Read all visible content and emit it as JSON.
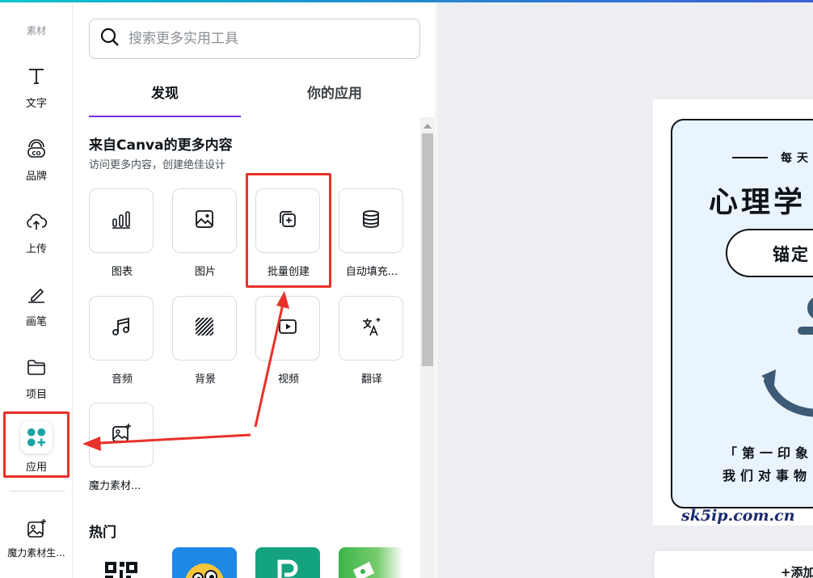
{
  "colors": {
    "accent_purple": "#7d2ae8",
    "annotation_red": "#e8312a",
    "apps_teal": "#1aa3a3"
  },
  "rail": {
    "top_label": "素材",
    "items": [
      {
        "label": "文字",
        "icon": "text-icon"
      },
      {
        "label": "品牌",
        "icon": "brand-icon"
      },
      {
        "label": "上传",
        "icon": "cloud-upload-icon"
      },
      {
        "label": "画笔",
        "icon": "pen-icon"
      },
      {
        "label": "项目",
        "icon": "folder-icon"
      },
      {
        "label": "应用",
        "icon": "apps-icon"
      },
      {
        "label": "魔力素材生...",
        "icon": "magic-media-icon"
      }
    ]
  },
  "panel": {
    "search_placeholder": "搜索更多实用工具",
    "tabs": [
      "发现",
      "你的应用"
    ],
    "section_title": "来自Canva的更多内容",
    "section_subtitle": "访问更多内容，创建绝佳设计",
    "tools": [
      {
        "label": "图表",
        "icon": "bar-chart-icon"
      },
      {
        "label": "图片",
        "icon": "image-icon"
      },
      {
        "label": "批量创建",
        "icon": "bulk-create-icon"
      },
      {
        "label": "自动填充...",
        "icon": "database-icon"
      },
      {
        "label": "音频",
        "icon": "music-note-icon"
      },
      {
        "label": "背景",
        "icon": "background-pattern-icon"
      },
      {
        "label": "视频",
        "icon": "video-play-icon"
      },
      {
        "label": "翻译",
        "icon": "translate-icon"
      },
      {
        "label": "魔力素材...",
        "icon": "magic-image-icon"
      }
    ],
    "hot_title": "热门"
  },
  "canvas": {
    "daily": "每天",
    "title": "心理学",
    "pill": "锚定",
    "quote_line1": "「第一印象",
    "quote_line2": "我们对事物",
    "watermark": "sk5ip.com.cn",
    "add_page": "+添加"
  }
}
